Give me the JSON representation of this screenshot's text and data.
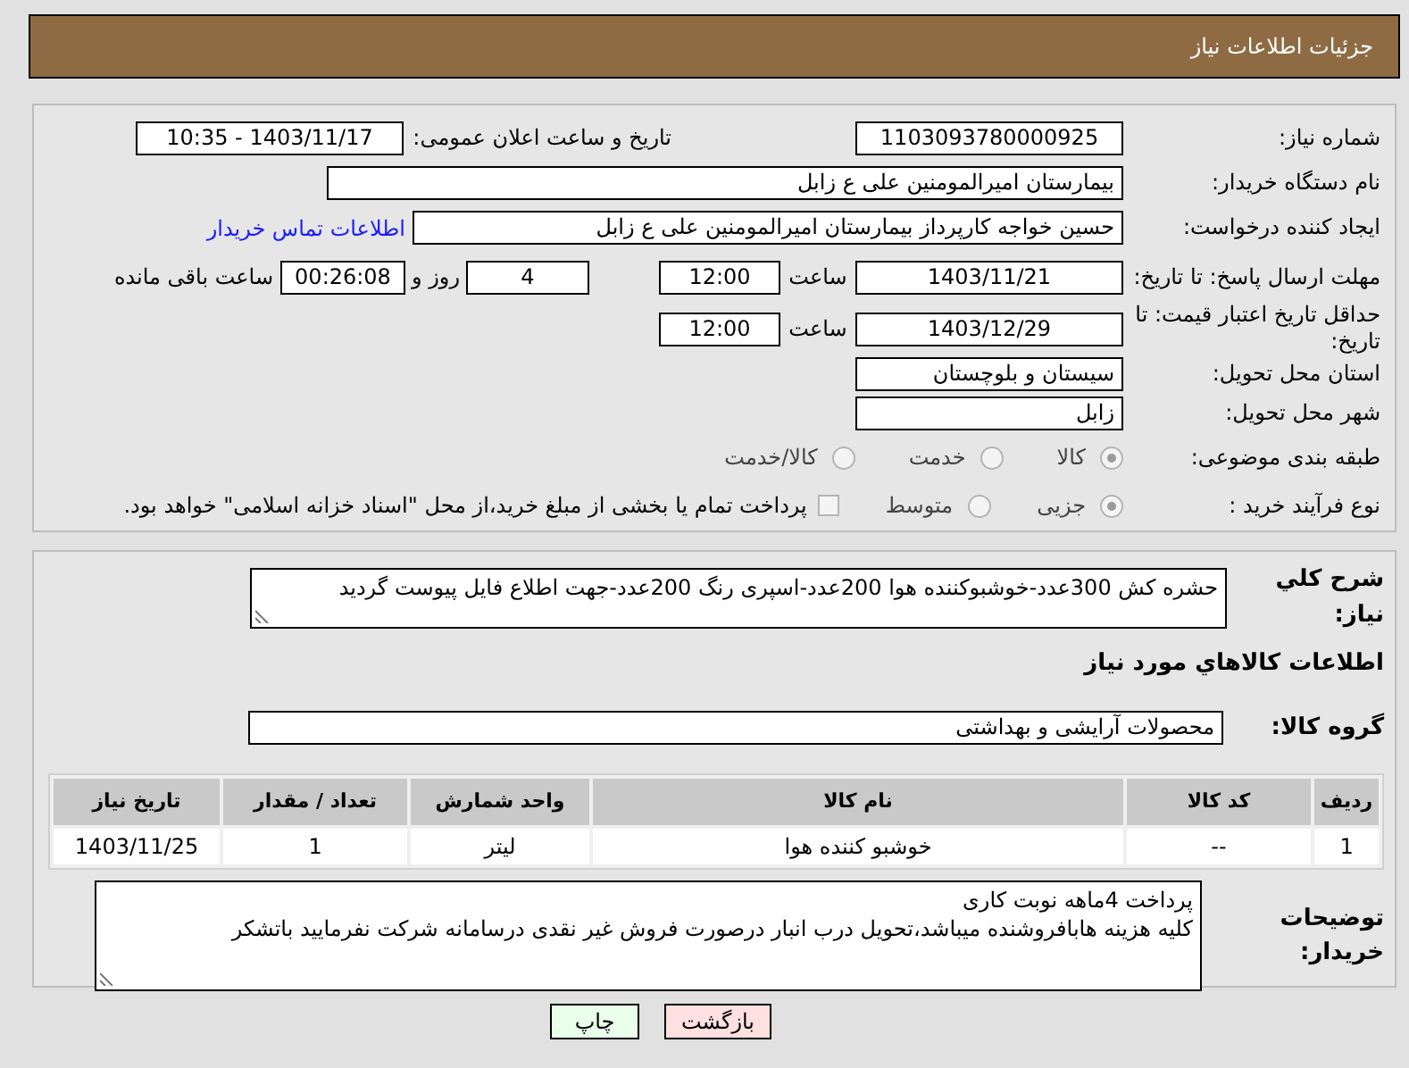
{
  "header": {
    "title": "جزئیات اطلاعات نیاز"
  },
  "details": {
    "need_number": {
      "label": "شماره نیاز:",
      "value": "1103093780000925"
    },
    "announce": {
      "label": "تاریخ و ساعت اعلان عمومی:",
      "value": "1403/11/17 - 10:35"
    },
    "buyer_org": {
      "label": "نام دستگاه خریدار:",
      "value": "بیمارستان امیرالمومنین علی  ع  زابل"
    },
    "requester": {
      "label": "ایجاد کننده درخواست:",
      "value": "حسین خواجه کارپرداز بیمارستان امیرالمومنین علی  ع  زابل",
      "link": "اطلاعات تماس خریدار"
    },
    "response_deadline": {
      "label": "مهلت ارسال پاسخ: تا تاریخ:",
      "date": "1403/11/21",
      "time_label": "ساعت",
      "time": "12:00",
      "days": "4",
      "days_label": "روز و",
      "remaining": "00:26:08",
      "remaining_label": "ساعت باقی مانده"
    },
    "price_validity": {
      "label": "حداقل تاریخ اعتبار قیمت: تا تاریخ:",
      "date": "1403/12/29",
      "time_label": "ساعت",
      "time": "12:00"
    },
    "province": {
      "label": "استان محل تحویل:",
      "value": "سیستان و بلوچستان"
    },
    "city": {
      "label": "شهر محل تحویل:",
      "value": "زابل"
    },
    "category": {
      "label": "طبقه بندی موضوعی:",
      "options": [
        {
          "label": "کالا",
          "selected": true
        },
        {
          "label": "خدمت",
          "selected": false
        },
        {
          "label": "کالا/خدمت",
          "selected": false
        }
      ]
    },
    "purchase_process": {
      "label": "نوع فرآیند خرید :",
      "options": [
        {
          "label": "جزیی",
          "selected": true
        },
        {
          "label": "متوسط",
          "selected": false
        }
      ],
      "treasury": {
        "checked": false,
        "text": "پرداخت تمام یا بخشی از مبلغ خرید،از محل \"اسناد خزانه اسلامی\" خواهد بود."
      }
    }
  },
  "description": {
    "label": "شرح کلي نیاز:",
    "value": "حشره کش 300عدد-خوشبوکننده هوا 200عدد-اسپری رنگ 200عدد-جهت اطلاع فایل پیوست گردید"
  },
  "goods": {
    "title": "اطلاعات کالاهاي مورد نياز",
    "group": {
      "label": "گروه کالا:",
      "value": "محصولات آرایشی و بهداشتی"
    },
    "table": {
      "columns": [
        "ردیف",
        "کد کالا",
        "نام کالا",
        "واحد شمارش",
        "تعداد / مقدار",
        "تاریخ نیاز"
      ],
      "rows": [
        [
          "1",
          "--",
          "خوشبو کننده هوا",
          "لیتر",
          "1",
          "1403/11/25"
        ]
      ]
    }
  },
  "buyer_notes": {
    "label": "توضیحات خریدار:",
    "lines": [
      "پرداخت 4ماهه نوبت کاری",
      "کلیه هزینه هابافروشنده میباشد،تحویل درب انبار درصورت فروش غیر نقدی درسامانه شرکت نفرمایید باتشکر"
    ]
  },
  "buttons": [
    {
      "label": "بازگشت",
      "kind": "back"
    },
    {
      "label": "چاپ",
      "kind": "print"
    }
  ]
}
